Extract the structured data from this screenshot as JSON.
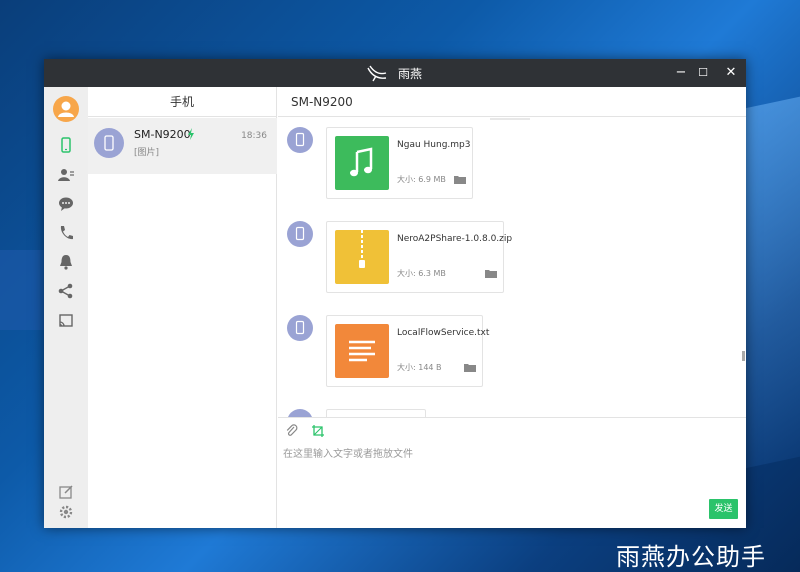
{
  "app": {
    "title": "雨燕",
    "watermark": "雨燕办公助手"
  },
  "window_controls": {
    "minimize": "−",
    "maximize": "☐",
    "close": "✕"
  },
  "list": {
    "header": "手机",
    "contacts": [
      {
        "name": "SM-N9200",
        "time": "18:36",
        "preview": "[图片]"
      }
    ]
  },
  "chat": {
    "title": "SM-N9200",
    "messages": [
      {
        "file_name": "Ngau Hung.mp3",
        "size": "大小: 6.9 MB",
        "type": "audio",
        "color": "#3dbb5c"
      },
      {
        "file_name": "NeroA2PShare-1.0.8.0.zip",
        "size": "大小: 6.3 MB",
        "type": "archive",
        "color": "#f0c137"
      },
      {
        "file_name": "LocalFlowService.txt",
        "size": "大小: 144 B",
        "type": "text",
        "color": "#f2883a"
      }
    ],
    "input_placeholder": "在这里输入文字或者拖放文件",
    "send_label": "发送"
  },
  "colors": {
    "accent": "#2bc36b",
    "titlebar": "#2f3236",
    "avatar": "#9aa3d4"
  }
}
